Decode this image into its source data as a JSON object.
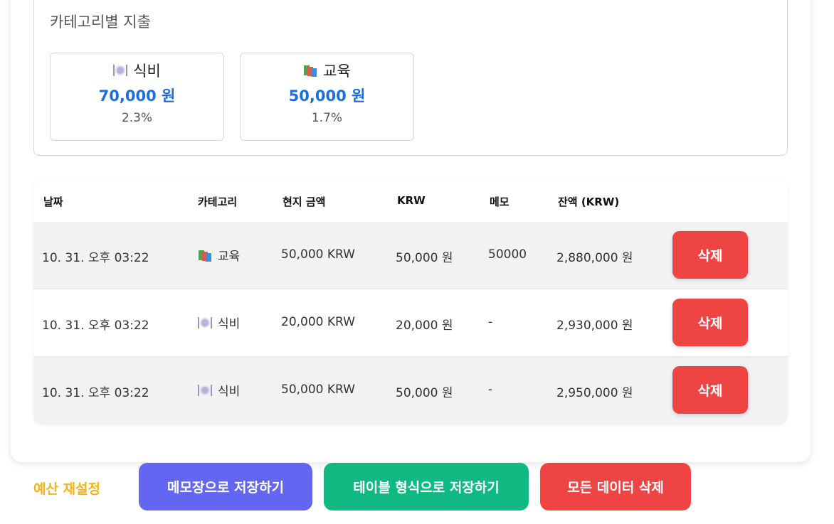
{
  "category_panel": {
    "title": "카테고리별 지출",
    "cards": [
      {
        "icon": "plate-icon",
        "name": "식비",
        "amount": "70,000 원",
        "percent": "2.3%"
      },
      {
        "icon": "books-icon",
        "name": "교육",
        "amount": "50,000 원",
        "percent": "1.7%"
      }
    ]
  },
  "table": {
    "headers": [
      "날짜",
      "카테고리",
      "현지 금액",
      "KRW",
      "메모",
      "잔액 (KRW)"
    ],
    "rows": [
      {
        "date": "10. 31. 오후 03:22",
        "icon": "books-icon",
        "category": "교육",
        "local_amount": "50,000 KRW",
        "krw": "50,000 원",
        "memo": "50000",
        "balance": "2,880,000 원",
        "delete_label": "삭제"
      },
      {
        "date": "10. 31. 오후 03:22",
        "icon": "plate-icon",
        "category": "식비",
        "local_amount": "20,000 KRW",
        "krw": "20,000 원",
        "memo": "-",
        "balance": "2,930,000 원",
        "delete_label": "삭제"
      },
      {
        "date": "10. 31. 오후 03:22",
        "icon": "plate-icon",
        "category": "식비",
        "local_amount": "50,000 KRW",
        "krw": "50,000 원",
        "memo": "-",
        "balance": "2,950,000 원",
        "delete_label": "삭제"
      }
    ]
  },
  "footer": {
    "reset_budget": "예산 재설정",
    "save_memo": "메모장으로 저장하기",
    "save_table": "테이블 형식으로 저장하기",
    "delete_all": "모든 데이터 삭제"
  },
  "colors": {
    "accent_blue": "#1a6fe0",
    "danger": "#ef4444",
    "indigo": "#6366f1",
    "green": "#10b981",
    "amber": "#f5b318"
  }
}
